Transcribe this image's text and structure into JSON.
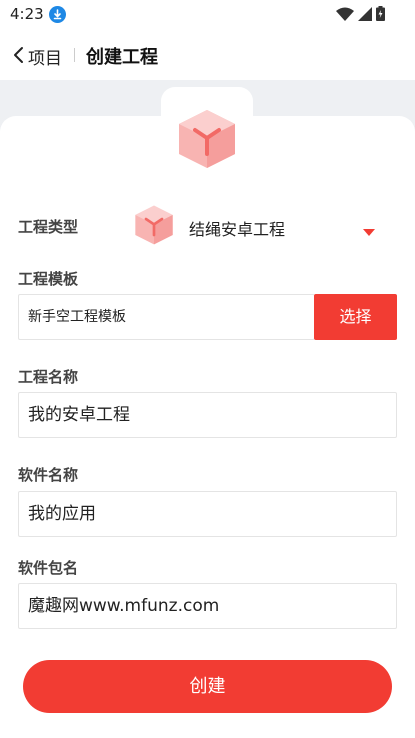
{
  "status_bar": {
    "time": "4:23",
    "icons": [
      "download-icon",
      "wifi-icon",
      "signal-icon",
      "battery-icon"
    ]
  },
  "app_bar": {
    "back_label": "项目",
    "title": "创建工程"
  },
  "form": {
    "project_type": {
      "label": "工程类型",
      "value": "结绳安卓工程"
    },
    "template": {
      "label": "工程模板",
      "value": "新手空工程模板",
      "select_label": "选择"
    },
    "project_name": {
      "label": "工程名称",
      "value": "我的安卓工程"
    },
    "app_name": {
      "label": "软件名称",
      "value": "我的应用"
    },
    "package_name": {
      "label": "软件包名",
      "value": "魔趣网www.mfunz.com"
    },
    "create_label": "创建"
  },
  "colors": {
    "accent": "#f23c33",
    "cube": "#f7a8a6",
    "background": "#eef0f3"
  }
}
